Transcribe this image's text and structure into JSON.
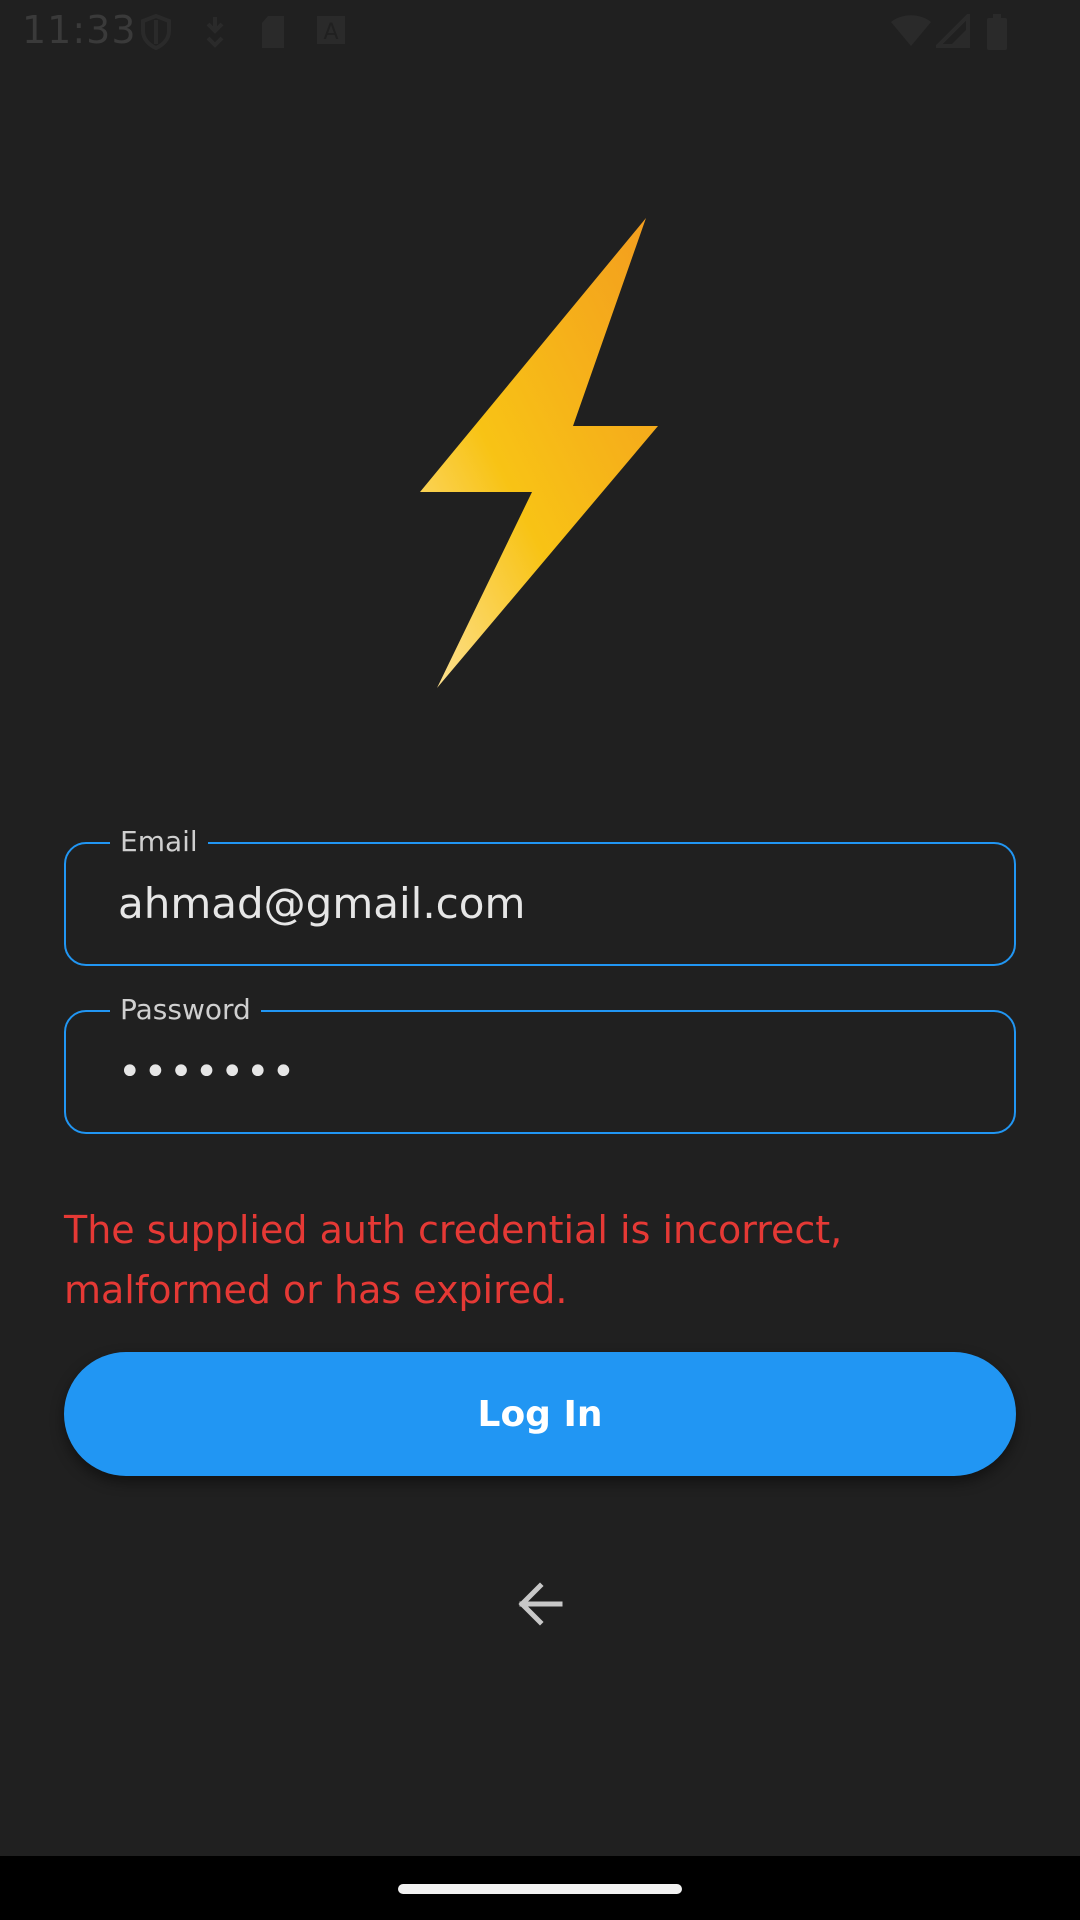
{
  "status_bar": {
    "time": "11:33",
    "icons_left": [
      "shield-icon",
      "download-icon",
      "sd-card-icon",
      "text-a-icon"
    ],
    "icons_right": [
      "wifi-icon",
      "signal-icon",
      "battery-icon"
    ]
  },
  "logo": {
    "icon": "lightning-bolt-icon",
    "colors": [
      "#fcd56a",
      "#f7c21a",
      "#f3a21f"
    ]
  },
  "form": {
    "email": {
      "label": "Email",
      "value": "ahmad@gmail.com"
    },
    "password": {
      "label": "Password",
      "value": "•••••••"
    },
    "error": "The supplied auth credential is incorrect, malformed or has expired.",
    "login_label": "Log In",
    "back_icon": "arrow-left-icon"
  },
  "colors": {
    "background": "#202020",
    "accent": "#2196f3",
    "error": "#e53935"
  }
}
